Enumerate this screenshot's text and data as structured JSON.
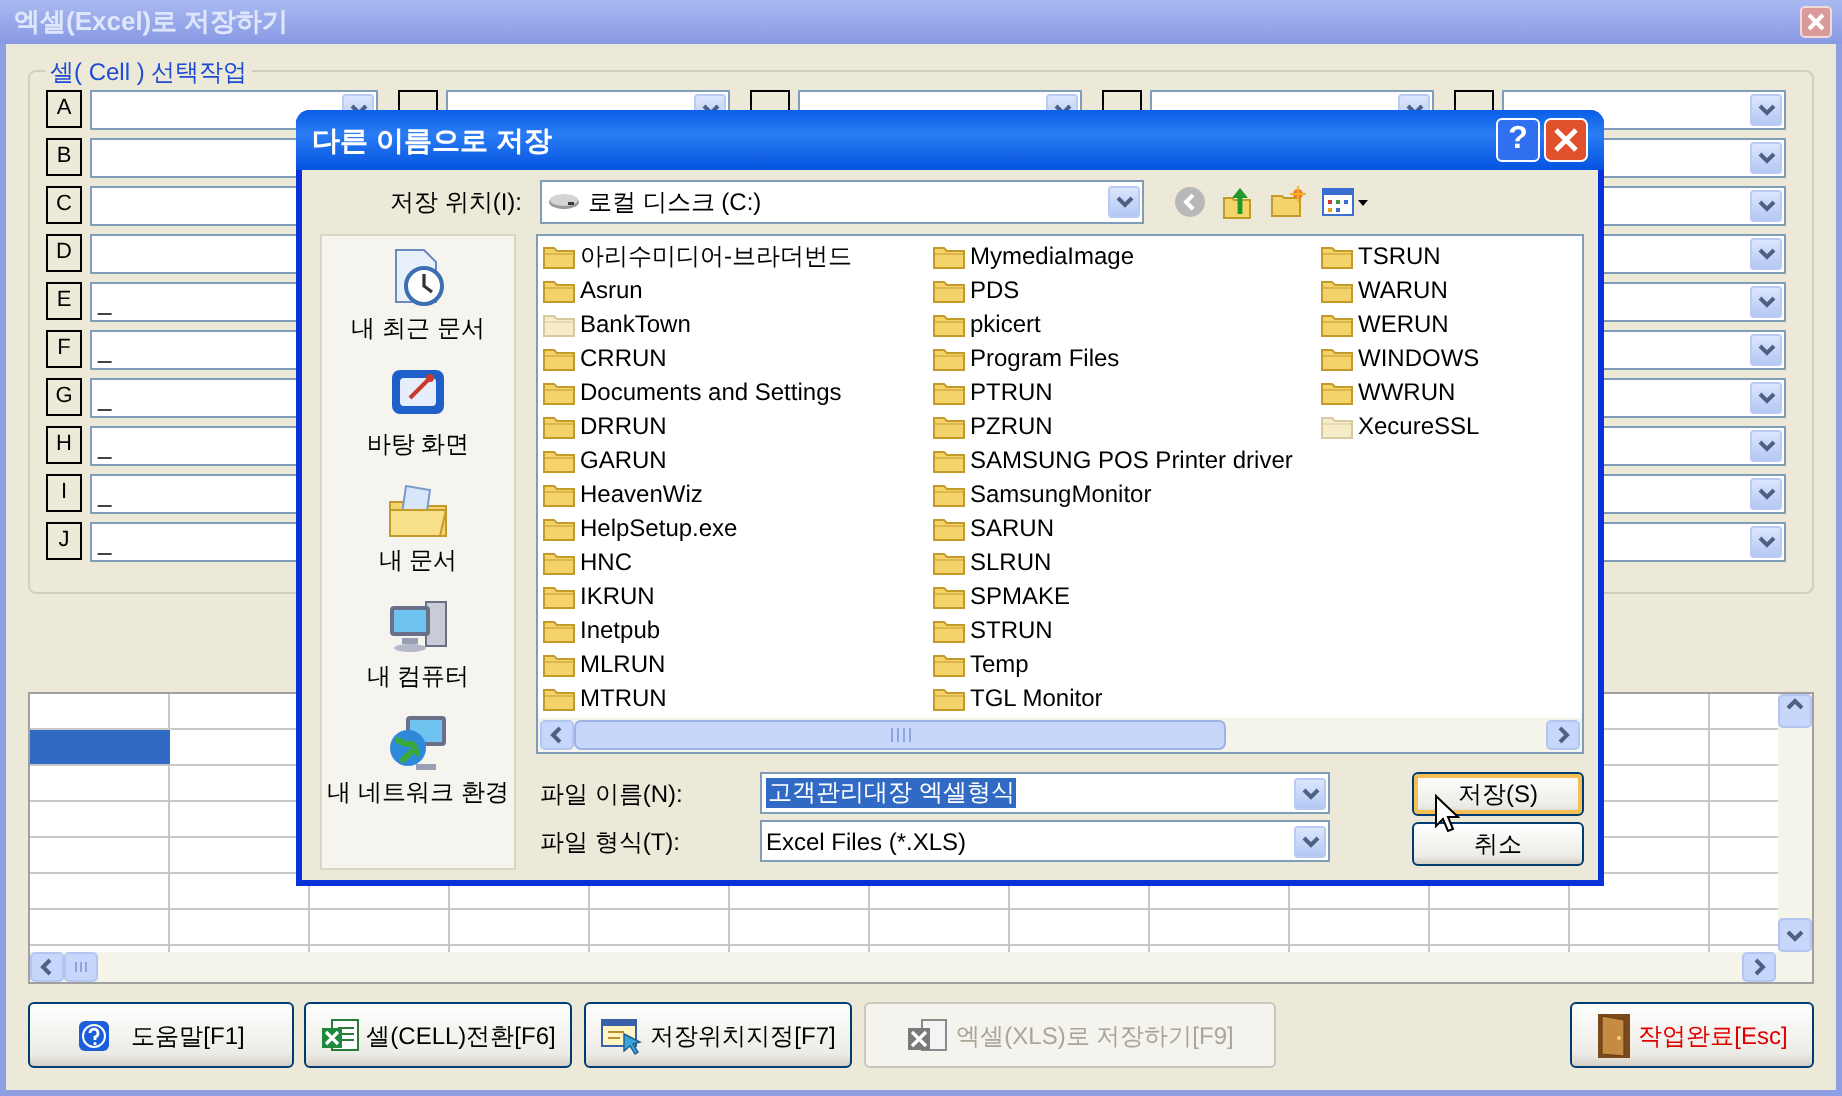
{
  "window": {
    "title": "엑셀(Excel)로 저장하기"
  },
  "cell_selection": {
    "title": "셀( Cell ) 선택작업",
    "rows": [
      {
        "fields": [
          {
            "kind": "combo",
            "label": "A"
          },
          {
            "kind": "combo"
          },
          {
            "kind": "combo"
          },
          {
            "kind": "combo"
          },
          {
            "kind": "combo"
          }
        ]
      },
      {
        "fields": [
          {
            "kind": "text",
            "label": "B"
          },
          {
            "kind": "combo"
          }
        ]
      },
      {
        "fields": [
          {
            "kind": "text",
            "label": "C"
          },
          {
            "kind": "combo"
          }
        ]
      },
      {
        "fields": [
          {
            "kind": "text",
            "label": "D"
          },
          {
            "kind": "combo"
          }
        ]
      },
      {
        "fields": [
          {
            "kind": "text",
            "label": "E",
            "value": "_"
          },
          {
            "kind": "combo"
          }
        ]
      },
      {
        "fields": [
          {
            "kind": "text",
            "label": "F",
            "value": "_"
          },
          {
            "kind": "combo"
          }
        ]
      },
      {
        "fields": [
          {
            "kind": "text",
            "label": "G",
            "value": "_"
          },
          {
            "kind": "combo"
          }
        ]
      },
      {
        "fields": [
          {
            "kind": "text",
            "label": "H",
            "value": "_"
          },
          {
            "kind": "combo"
          }
        ]
      },
      {
        "fields": [
          {
            "kind": "text",
            "label": "I",
            "value": "_"
          },
          {
            "kind": "combo"
          }
        ]
      },
      {
        "fields": [
          {
            "kind": "text",
            "label": "J",
            "value": "_"
          },
          {
            "kind": "combo"
          }
        ]
      }
    ]
  },
  "sheet": {
    "rows": [
      {
        "selected": true
      },
      {
        "selected": false
      },
      {
        "selected": false
      },
      {
        "selected": false
      },
      {
        "selected": false
      },
      {
        "selected": false
      }
    ]
  },
  "buttons": [
    {
      "kind": "help",
      "label": "도움말[F1]",
      "disabled": false
    },
    {
      "kind": "excel",
      "label": "셀(CELL)전환[F6]",
      "disabled": false
    },
    {
      "kind": "location",
      "label": "저장위치지정[F7]",
      "disabled": false
    },
    {
      "kind": "export",
      "label": "엑셀(XLS)로 저장하기[F9]",
      "disabled": true
    },
    {
      "kind": "exit",
      "label": "작업완료[Esc]",
      "disabled": false
    }
  ],
  "dialog": {
    "title": "다른 이름으로 저장",
    "help_button": "?",
    "location_label": "저장 위치(I):",
    "location": "로컬 디스크 (C:)",
    "places": [
      {
        "kind": "recent",
        "label": "내 최근 문서"
      },
      {
        "kind": "desktop",
        "label": "바탕 화면"
      },
      {
        "kind": "documents",
        "label": "내 문서"
      },
      {
        "kind": "computer",
        "label": "내 컴퓨터"
      },
      {
        "kind": "network",
        "label": "내 네트워크 환경"
      }
    ],
    "files": [
      {
        "name": "아리수미디어-브라더번드",
        "hidden": false
      },
      {
        "name": "Asrun",
        "hidden": false
      },
      {
        "name": "BankTown",
        "hidden": true
      },
      {
        "name": "CRRUN",
        "hidden": false
      },
      {
        "name": "Documents and Settings",
        "hidden": false
      },
      {
        "name": "DRRUN",
        "hidden": false
      },
      {
        "name": "GARUN",
        "hidden": false
      },
      {
        "name": "HeavenWiz",
        "hidden": false
      },
      {
        "name": "HelpSetup.exe",
        "hidden": false
      },
      {
        "name": "HNC",
        "hidden": false
      },
      {
        "name": "IKRUN",
        "hidden": false
      },
      {
        "name": "Inetpub",
        "hidden": false
      },
      {
        "name": "MLRUN",
        "hidden": false
      },
      {
        "name": "MTRUN",
        "hidden": false
      },
      {
        "name": "MymediaImage",
        "hidden": false
      },
      {
        "name": "PDS",
        "hidden": false
      },
      {
        "name": "pkicert",
        "hidden": false
      },
      {
        "name": "Program Files",
        "hidden": false
      },
      {
        "name": "PTRUN",
        "hidden": false
      },
      {
        "name": "PZRUN",
        "hidden": false
      },
      {
        "name": "SAMSUNG POS Printer driver",
        "hidden": false
      },
      {
        "name": "SamsungMonitor",
        "hidden": false
      },
      {
        "name": "SARUN",
        "hidden": false
      },
      {
        "name": "SLRUN",
        "hidden": false
      },
      {
        "name": "SPMAKE",
        "hidden": false
      },
      {
        "name": "STRUN",
        "hidden": false
      },
      {
        "name": "Temp",
        "hidden": false
      },
      {
        "name": "TGL Monitor",
        "hidden": false
      },
      {
        "name": "TSRUN",
        "hidden": false
      },
      {
        "name": "WARUN",
        "hidden": false
      },
      {
        "name": "WERUN",
        "hidden": false
      },
      {
        "name": "WINDOWS",
        "hidden": false
      },
      {
        "name": "WWRUN",
        "hidden": false
      },
      {
        "name": "XecureSSL",
        "hidden": true
      }
    ],
    "file_name_label": "파일 이름(N):",
    "file_name": "고객관리대장 엑셀형식",
    "file_name_selected": true,
    "file_type_label": "파일 형식(T):",
    "file_type": "Excel Files (*.XLS)",
    "save_button": "저장(S)",
    "cancel_button": "취소"
  }
}
